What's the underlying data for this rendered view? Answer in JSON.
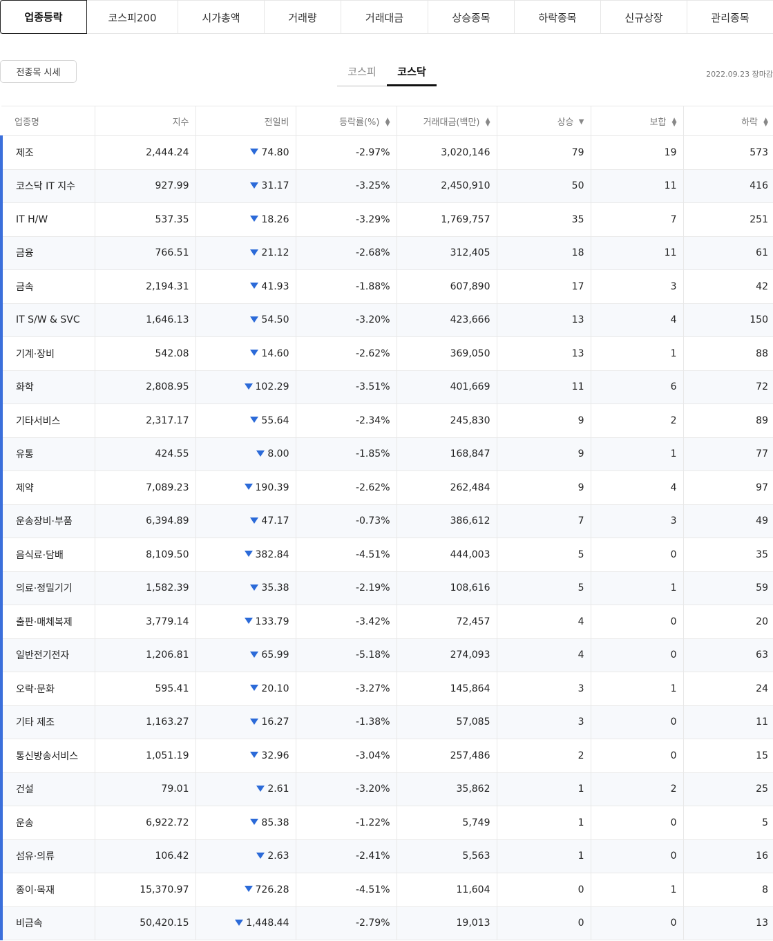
{
  "top_tabs": [
    "업종등락",
    "코스피200",
    "시가총액",
    "거래량",
    "거래대금",
    "상승종목",
    "하락종목",
    "신규상장",
    "관리종목"
  ],
  "all_quotes_button": "전종목 시세",
  "market_tabs": [
    "코스피",
    "코스닥"
  ],
  "active_market": "코스닥",
  "date_label": "2022.09.23 장마감",
  "colors": {
    "down": "#2b6ad8",
    "row_marker": "#3b6fdb"
  },
  "table": {
    "columns": [
      "업종명",
      "지수",
      "전일비",
      "등락률(%)",
      "거래대금(백만)",
      "상승",
      "보합",
      "하락"
    ],
    "rows": [
      {
        "name": "제조",
        "index": "2,444.24",
        "change": "74.80",
        "rate": "-2.97%",
        "amount": "3,020,146",
        "up": "79",
        "flat": "19",
        "down": "573"
      },
      {
        "name": "코스닥 IT 지수",
        "index": "927.99",
        "change": "31.17",
        "rate": "-3.25%",
        "amount": "2,450,910",
        "up": "50",
        "flat": "11",
        "down": "416"
      },
      {
        "name": "IT H/W",
        "index": "537.35",
        "change": "18.26",
        "rate": "-3.29%",
        "amount": "1,769,757",
        "up": "35",
        "flat": "7",
        "down": "251"
      },
      {
        "name": "금융",
        "index": "766.51",
        "change": "21.12",
        "rate": "-2.68%",
        "amount": "312,405",
        "up": "18",
        "flat": "11",
        "down": "61"
      },
      {
        "name": "금속",
        "index": "2,194.31",
        "change": "41.93",
        "rate": "-1.88%",
        "amount": "607,890",
        "up": "17",
        "flat": "3",
        "down": "42"
      },
      {
        "name": "IT S/W & SVC",
        "index": "1,646.13",
        "change": "54.50",
        "rate": "-3.20%",
        "amount": "423,666",
        "up": "13",
        "flat": "4",
        "down": "150"
      },
      {
        "name": "기계·장비",
        "index": "542.08",
        "change": "14.60",
        "rate": "-2.62%",
        "amount": "369,050",
        "up": "13",
        "flat": "1",
        "down": "88"
      },
      {
        "name": "화학",
        "index": "2,808.95",
        "change": "102.29",
        "rate": "-3.51%",
        "amount": "401,669",
        "up": "11",
        "flat": "6",
        "down": "72"
      },
      {
        "name": "기타서비스",
        "index": "2,317.17",
        "change": "55.64",
        "rate": "-2.34%",
        "amount": "245,830",
        "up": "9",
        "flat": "2",
        "down": "89"
      },
      {
        "name": "유통",
        "index": "424.55",
        "change": "8.00",
        "rate": "-1.85%",
        "amount": "168,847",
        "up": "9",
        "flat": "1",
        "down": "77"
      },
      {
        "name": "제약",
        "index": "7,089.23",
        "change": "190.39",
        "rate": "-2.62%",
        "amount": "262,484",
        "up": "9",
        "flat": "4",
        "down": "97"
      },
      {
        "name": "운송장비·부품",
        "index": "6,394.89",
        "change": "47.17",
        "rate": "-0.73%",
        "amount": "386,612",
        "up": "7",
        "flat": "3",
        "down": "49"
      },
      {
        "name": "음식료·담배",
        "index": "8,109.50",
        "change": "382.84",
        "rate": "-4.51%",
        "amount": "444,003",
        "up": "5",
        "flat": "0",
        "down": "35"
      },
      {
        "name": "의료·정밀기기",
        "index": "1,582.39",
        "change": "35.38",
        "rate": "-2.19%",
        "amount": "108,616",
        "up": "5",
        "flat": "1",
        "down": "59"
      },
      {
        "name": "출판·매체복제",
        "index": "3,779.14",
        "change": "133.79",
        "rate": "-3.42%",
        "amount": "72,457",
        "up": "4",
        "flat": "0",
        "down": "20"
      },
      {
        "name": "일반전기전자",
        "index": "1,206.81",
        "change": "65.99",
        "rate": "-5.18%",
        "amount": "274,093",
        "up": "4",
        "flat": "0",
        "down": "63"
      },
      {
        "name": "오락·문화",
        "index": "595.41",
        "change": "20.10",
        "rate": "-3.27%",
        "amount": "145,864",
        "up": "3",
        "flat": "1",
        "down": "24"
      },
      {
        "name": "기타 제조",
        "index": "1,163.27",
        "change": "16.27",
        "rate": "-1.38%",
        "amount": "57,085",
        "up": "3",
        "flat": "0",
        "down": "11"
      },
      {
        "name": "통신방송서비스",
        "index": "1,051.19",
        "change": "32.96",
        "rate": "-3.04%",
        "amount": "257,486",
        "up": "2",
        "flat": "0",
        "down": "15"
      },
      {
        "name": "건설",
        "index": "79.01",
        "change": "2.61",
        "rate": "-3.20%",
        "amount": "35,862",
        "up": "1",
        "flat": "2",
        "down": "25"
      },
      {
        "name": "운송",
        "index": "6,922.72",
        "change": "85.38",
        "rate": "-1.22%",
        "amount": "5,749",
        "up": "1",
        "flat": "0",
        "down": "5"
      },
      {
        "name": "섬유·의류",
        "index": "106.42",
        "change": "2.63",
        "rate": "-2.41%",
        "amount": "5,563",
        "up": "1",
        "flat": "0",
        "down": "16"
      },
      {
        "name": "종이·목재",
        "index": "15,370.97",
        "change": "726.28",
        "rate": "-4.51%",
        "amount": "11,604",
        "up": "0",
        "flat": "1",
        "down": "8"
      },
      {
        "name": "비금속",
        "index": "50,420.15",
        "change": "1,448.44",
        "rate": "-2.79%",
        "amount": "19,013",
        "up": "0",
        "flat": "0",
        "down": "13"
      }
    ]
  }
}
